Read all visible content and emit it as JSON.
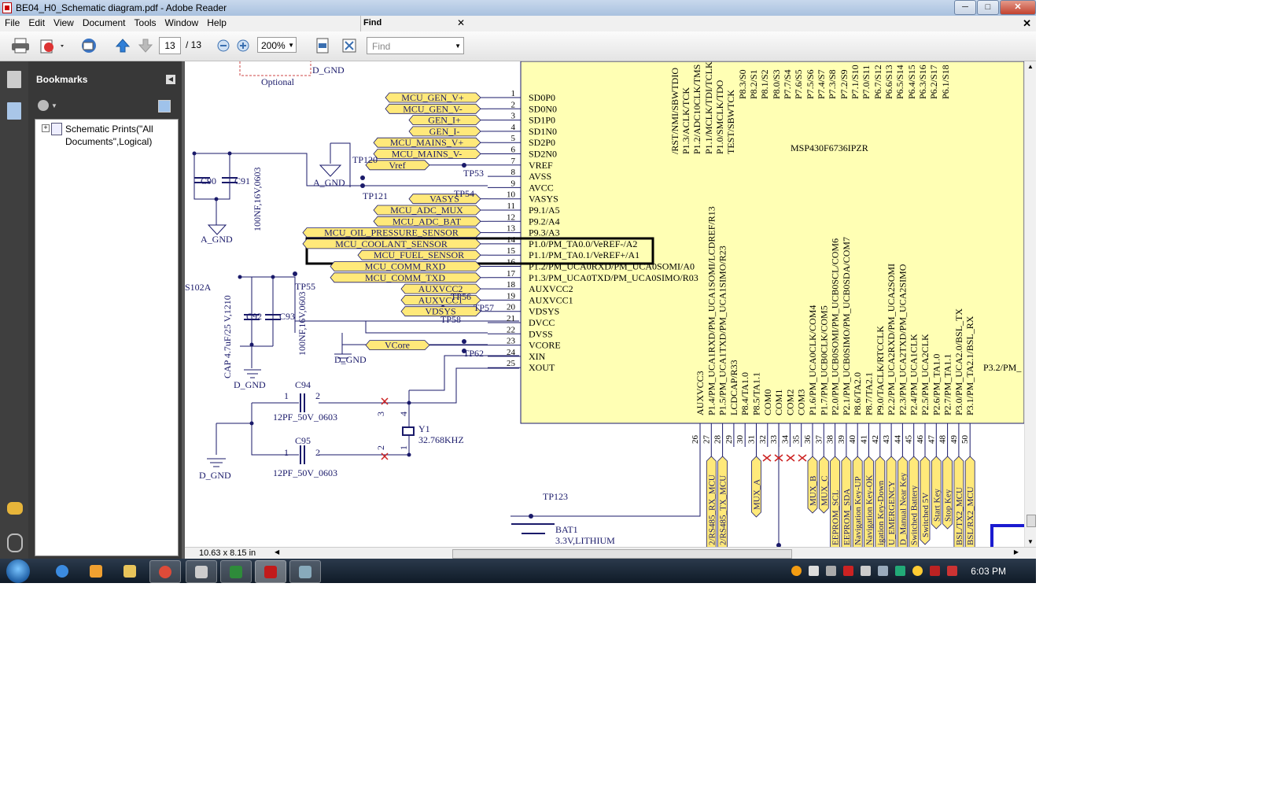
{
  "window": {
    "title": "BE04_H0_Schematic diagram.pdf - Adobe Reader",
    "min_label": "─",
    "max_label": "□",
    "close_label": "✕"
  },
  "menu": [
    "File",
    "Edit",
    "View",
    "Document",
    "Tools",
    "Window",
    "Help"
  ],
  "find_panel": {
    "label": "Find",
    "close": "✕",
    "placeholder": "Find"
  },
  "doc_close": "✕",
  "toolbar": {
    "page_current": "13",
    "page_total": "/ 13",
    "zoom": "200%"
  },
  "bookmarks": {
    "title": "Bookmarks",
    "item": "Schematic Prints(\"All Documents\",Logical)"
  },
  "status": {
    "dimensions": "10.63 x 8.15 in"
  },
  "taskbar": {
    "clock": "6:03 PM"
  },
  "schematic": {
    "chip": "MSP430F6736IPZR",
    "left_pins": [
      {
        "n": "1",
        "name": "SD0P0"
      },
      {
        "n": "2",
        "name": "SD0N0"
      },
      {
        "n": "3",
        "name": "SD1P0"
      },
      {
        "n": "4",
        "name": "SD1N0"
      },
      {
        "n": "5",
        "name": "SD2P0"
      },
      {
        "n": "6",
        "name": "SD2N0"
      },
      {
        "n": "7",
        "name": "VREF"
      },
      {
        "n": "8",
        "name": "AVSS"
      },
      {
        "n": "9",
        "name": "AVCC"
      },
      {
        "n": "10",
        "name": "VASYS"
      },
      {
        "n": "11",
        "name": "P9.1/A5"
      },
      {
        "n": "12",
        "name": "P9.2/A4"
      },
      {
        "n": "13",
        "name": "P9.3/A3"
      },
      {
        "n": "14",
        "name": "P1.0/PM_TA0.0/VeREF-/A2"
      },
      {
        "n": "15",
        "name": "P1.1/PM_TA0.1/VeREF+/A1"
      },
      {
        "n": "16",
        "name": "P1.2/PM_UCA0RXD/PM_UCA0SOMI/A0"
      },
      {
        "n": "17",
        "name": "P1.3/PM_UCA0TXD/PM_UCA0SIMO/R03"
      },
      {
        "n": "18",
        "name": "AUXVCC2"
      },
      {
        "n": "19",
        "name": "AUXVCC1"
      },
      {
        "n": "20",
        "name": "VDSYS"
      },
      {
        "n": "21",
        "name": "DVCC"
      },
      {
        "n": "22",
        "name": "DVSS"
      },
      {
        "n": "23",
        "name": "VCORE"
      },
      {
        "n": "24",
        "name": "XIN"
      },
      {
        "n": "25",
        "name": "XOUT"
      }
    ],
    "left_nets": [
      "MCU_GEN_V+",
      "MCU_GEN_V-",
      "GEN_I+",
      "GEN_I-",
      "MCU_MAINS_V+",
      "MCU_MAINS_V-",
      "Vref",
      "VASYS",
      "MCU_ADC_MUX",
      "MCU_ADC_BAT",
      "MCU_OIL_PRESSURE_SENSOR",
      "MCU_COOLANT_SENSOR",
      "MCU_FUEL_SENSOR",
      "MCU_COMM_RXD",
      "MCU_COMM_TXD",
      "AUXVCC2",
      "AUXVCC1",
      "VDSYS",
      "VCore"
    ],
    "top_pins": [
      "/RST/NMI/SBWTDIO",
      "P1.3/ACLK/TCK",
      "P1.2/ADC10CLK/TMS",
      "P1.1/MCLK/TDI/TCLK",
      "P1.0/SMCLK/TDO",
      "TEST/SBWTCK",
      "P8.3/S0",
      "P8.2/S1",
      "P8.1/S2",
      "P8.0/S3",
      "P7.7/S4",
      "P7.6/S5",
      "P7.5/S6",
      "P7.4/S7",
      "P7.3/S8",
      "P7.2/S9",
      "P7.1/S10",
      "P7.0/S11",
      "P6.7/S12",
      "P6.6/S13",
      "P6.5/S14",
      "P6.4/S15",
      "P6.3/S16",
      "P6.2/S17",
      "P6.1/S18"
    ],
    "bottom_pins": [
      {
        "n": "26",
        "name": "AUXVCC3"
      },
      {
        "n": "27",
        "name": "P1.4/PM_UCA1RXD/PM_UCA1SOMI/LCDREF/R13"
      },
      {
        "n": "28",
        "name": "P1.5/PM_UCA1TXD/PM_UCA1SIMO/R23"
      },
      {
        "n": "29",
        "name": "LCDCAP/R33"
      },
      {
        "n": "30",
        "name": "P8.4/TA1.0"
      },
      {
        "n": "31",
        "name": "P8.5/TA1.1"
      },
      {
        "n": "32",
        "name": "COM0"
      },
      {
        "n": "33",
        "name": "COM1"
      },
      {
        "n": "34",
        "name": "COM2"
      },
      {
        "n": "35",
        "name": "COM3"
      },
      {
        "n": "36",
        "name": "P1.6/PM_UCA0CLK/COM4"
      },
      {
        "n": "37",
        "name": "P1.7/PM_UCB0CLK/COM5"
      },
      {
        "n": "38",
        "name": "P2.0/PM_UCB0SOMI/PM_UCB0SCL/COM6"
      },
      {
        "n": "39",
        "name": "P2.1/PM_UCB0SIMO/PM_UCB0SDA/COM7"
      },
      {
        "n": "40",
        "name": "P8.6/TA2.0"
      },
      {
        "n": "41",
        "name": "P8.7/TA2.1"
      },
      {
        "n": "42",
        "name": "P9.0/TACLK/RTCCLK"
      },
      {
        "n": "43",
        "name": "P2.2/PM_UCA2RXD/PM_UCA2SOMI"
      },
      {
        "n": "44",
        "name": "P2.3/PM_UCA2TXD/PM_UCA2SIMO"
      },
      {
        "n": "45",
        "name": "P2.4/PM_UCA1CLK"
      },
      {
        "n": "46",
        "name": "P2.5/PM_UCA2CLK"
      },
      {
        "n": "47",
        "name": "P2.6/PM_TA1.0"
      },
      {
        "n": "48",
        "name": "P2.7/PM_TA1.1"
      },
      {
        "n": "49",
        "name": "P3.0/PM_UCA2.0/BSL_TX"
      },
      {
        "n": "50",
        "name": "P3.1/PM_TA2.1/BSL_RX"
      }
    ],
    "bottom_nets": [
      "2/RS485_RX_MCU",
      "2/RS485_TX_MCU",
      "MUX_A",
      "MUX_B",
      "MUX_C",
      "EEPROM_SCL",
      "EEPROM_SDA",
      "Navigation Key-UP",
      "Navigation Key-OK",
      "igation Key-Down",
      "U_EMERGENCY",
      "D_Manual Near Key",
      "Switched Battery",
      "Switched 5V",
      "Start Key",
      "Stop Key",
      "BSL/TX2_MCU",
      "BSL/RX2_MCU"
    ],
    "right_pin": "P3.2/PM_",
    "labels": {
      "optional": "Optional",
      "dgnd": "D_GND",
      "agnd_top": "A_GND",
      "agnd": "A_GND",
      "c90": "C90",
      "c91": "C91",
      "c92": "C92",
      "c93": "C93",
      "c94": "C94",
      "c95": "C95",
      "cap1": "100NF,16V,0603",
      "cap2": "CAP 4.7uF/25 V,1210",
      "cap3": "100NF,16V,0603",
      "c94val": "12PF_50V_0603",
      "c95val": "12PF_50V_0603",
      "y1": "Y1",
      "y1val": "32.768KHZ",
      "tp120": "TP120",
      "tp121": "TP121",
      "tp53": "TP53",
      "tp54": "TP54",
      "tp55": "TP55",
      "tp56": "TP56",
      "tp57": "TP57",
      "tp58": "TP58",
      "tp62": "TP62",
      "tp123": "TP123",
      "s102a": "S102A",
      "bat1": "BAT1",
      "batval": "3.3V,LITHIUM",
      "one": "1",
      "two": "2",
      "three": "3",
      "four": "4"
    }
  }
}
